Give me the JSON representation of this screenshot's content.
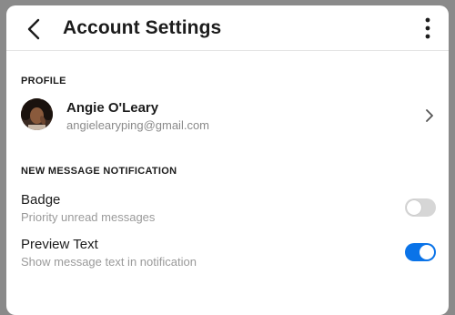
{
  "header": {
    "title": "Account Settings",
    "back_icon": "chevron-left-icon",
    "more_icon": "more-vertical-icon"
  },
  "profile": {
    "section_label": "PROFILE",
    "name": "Angie O'Leary",
    "email": "angielearyping@gmail.com",
    "chevron_icon": "chevron-right-icon"
  },
  "notifications": {
    "section_label": "NEW MESSAGE NOTIFICATION",
    "badge": {
      "title": "Badge",
      "description": "Priority unread messages",
      "enabled": false
    },
    "preview_text": {
      "title": "Preview Text",
      "description": "Show message text in notification",
      "enabled": true
    }
  },
  "colors": {
    "toggle_on": "#0a73e8",
    "toggle_off": "#d6d6d6"
  }
}
